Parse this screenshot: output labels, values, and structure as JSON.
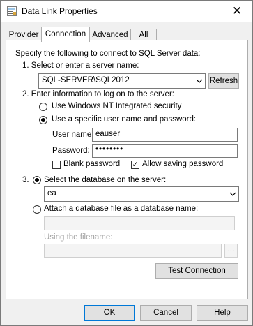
{
  "window": {
    "title": "Data Link Properties",
    "close_glyph": "✕"
  },
  "tabs": [
    {
      "label": "Provider"
    },
    {
      "label": "Connection"
    },
    {
      "label": "Advanced"
    },
    {
      "label": "All"
    }
  ],
  "connection": {
    "intro": "Specify the following to connect to SQL Server data:",
    "step1": "1. Select or enter a server name:",
    "server_value": "SQL-SERVER\\SQL2012",
    "refresh_label": "Refresh",
    "step2": "2. Enter information to log on to the server:",
    "radio_windows": "Use Windows NT Integrated security",
    "radio_specific": "Use a specific user name and password:",
    "username_label": "User name:",
    "username_value": "eauser",
    "password_label": "Password:",
    "password_value": "••••••••",
    "blank_password": "Blank password",
    "allow_saving": "Allow saving password",
    "check_mark": "✓",
    "step3_number": "3.",
    "select_db_label": "Select the database on the server:",
    "database_value": "ea",
    "attach_label": "Attach a database file as a database name:",
    "filename_label": "Using the filename:",
    "browse_label": "...",
    "test_connection": "Test Connection"
  },
  "buttons": {
    "ok": "OK",
    "cancel": "Cancel",
    "help": "Help"
  }
}
